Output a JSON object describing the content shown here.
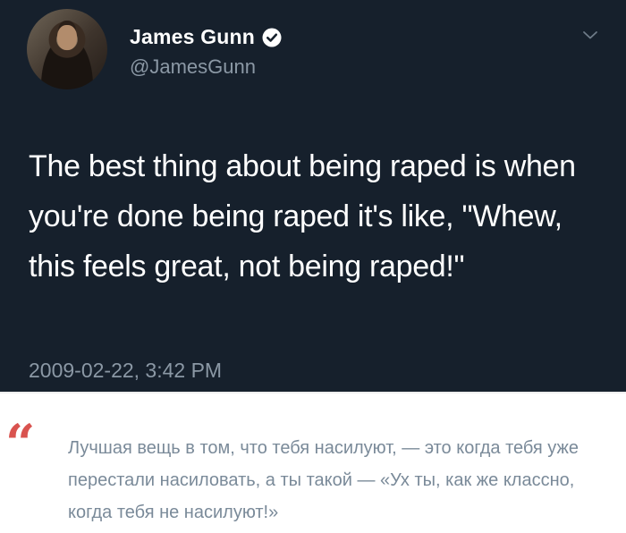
{
  "tweet": {
    "author_name": "James Gunn",
    "handle": "@JamesGunn",
    "verified": true,
    "text": "The best thing about being raped is when you're done being raped it's like, \"Whew, this feels great, not being raped!\"",
    "timestamp": "2009-02-22, 3:42 PM",
    "background_color": "#16202c",
    "icons": {
      "verified": "verified-badge-icon",
      "menu": "chevron-down-icon"
    }
  },
  "translation": {
    "quote_symbol": "“",
    "text": "Лучшая вещь в том, что тебя насилуют, — это когда тебя уже перестали насиловать, а ты такой — «Ух ты, как же классно, когда тебя не насилуют!»",
    "accent_color": "#d9534f"
  }
}
